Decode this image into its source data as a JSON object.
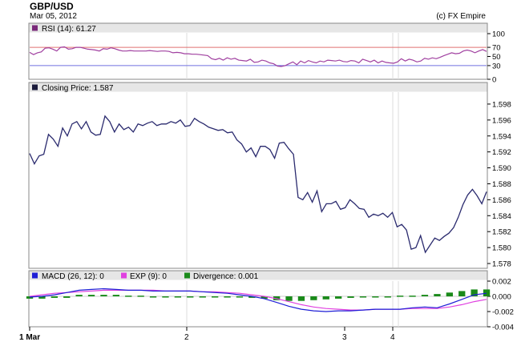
{
  "header": {
    "title": "GBP/USD",
    "date": "Mar 05, 2012",
    "copyright": "(c) FX Empire"
  },
  "colors": {
    "rsi_line": "#a040a0",
    "rsi_fill": "#5050e0",
    "price_line": "#2a2a6e",
    "macd_line": "#1f1fd6",
    "exp_line": "#e040e0",
    "divergence": "#1a8a1a",
    "overbought": "#e07070",
    "oversold": "#7070e0",
    "panel_header": "#e6e6e6"
  },
  "x_axis": {
    "ticks": [
      "1 Mar",
      "2",
      "3",
      "4"
    ]
  },
  "chart_data": [
    {
      "type": "line",
      "title": "RSI (14): 61.27",
      "legend": "RSI (14): 61.27",
      "ylim": [
        0,
        100
      ],
      "yticks": [
        0,
        30,
        50,
        70,
        100
      ],
      "levels": [
        30,
        70
      ],
      "values": [
        59,
        54,
        58,
        60,
        68,
        69,
        66,
        62,
        70,
        71,
        66,
        67,
        70,
        70,
        68,
        66,
        65,
        64,
        62,
        67,
        66,
        69,
        67,
        64,
        62,
        62,
        63,
        62,
        62,
        62,
        62,
        63,
        62,
        61,
        62,
        62,
        61,
        58,
        59,
        58,
        56,
        56,
        55,
        55,
        54,
        53,
        52,
        45,
        43,
        46,
        42,
        47,
        44,
        46,
        42,
        41,
        40,
        44,
        37,
        38,
        42,
        40,
        36,
        34,
        29,
        28,
        30,
        34,
        38,
        32,
        40,
        36,
        41,
        38,
        36,
        40,
        38,
        42,
        41,
        40,
        42,
        39,
        38,
        41,
        40,
        36,
        44,
        41,
        38,
        42,
        36,
        40,
        37,
        36,
        35,
        38,
        45,
        40,
        44,
        42,
        38,
        40,
        46,
        44,
        47,
        45,
        48,
        52,
        55,
        58,
        56,
        57,
        62,
        64,
        62,
        58,
        62,
        65,
        61
      ]
    },
    {
      "type": "line",
      "title": "Closing Price: 1.587",
      "legend": "Closing Price: 1.587",
      "ylim": [
        1.5775,
        1.5995
      ],
      "yticks": [
        1.578,
        1.58,
        1.582,
        1.584,
        1.586,
        1.588,
        1.59,
        1.592,
        1.594,
        1.596,
        1.598
      ],
      "values": [
        1.5918,
        1.5905,
        1.5915,
        1.5917,
        1.5942,
        1.5936,
        1.5927,
        1.595,
        1.594,
        1.5955,
        1.5958,
        1.5949,
        1.5958,
        1.5945,
        1.5941,
        1.5942,
        1.5965,
        1.5958,
        1.5945,
        1.5955,
        1.5948,
        1.5951,
        1.5945,
        1.5955,
        1.5953,
        1.5956,
        1.5958,
        1.5953,
        1.5955,
        1.5955,
        1.5958,
        1.5956,
        1.596,
        1.5952,
        1.5953,
        1.5962,
        1.5958,
        1.5955,
        1.5951,
        1.5949,
        1.5947,
        1.5948,
        1.5944,
        1.5945,
        1.5935,
        1.593,
        1.592,
        1.5925,
        1.5914,
        1.5927,
        1.5927,
        1.5923,
        1.5912,
        1.5931,
        1.5932,
        1.5924,
        1.5917,
        1.5863,
        1.586,
        1.5869,
        1.5857,
        1.5871,
        1.5845,
        1.5855,
        1.5855,
        1.5858,
        1.5848,
        1.585,
        1.586,
        1.5855,
        1.5849,
        1.5848,
        1.5838,
        1.5842,
        1.584,
        1.5843,
        1.5838,
        1.5844,
        1.5826,
        1.5829,
        1.5822,
        1.5798,
        1.58,
        1.5815,
        1.5794,
        1.5803,
        1.5812,
        1.5809,
        1.5814,
        1.5818,
        1.5825,
        1.5838,
        1.5854,
        1.5866,
        1.5873,
        1.5865,
        1.5855,
        1.587
      ]
    },
    {
      "type": "line",
      "title": "MACD (26, 12): 0",
      "legend": [
        {
          "name": "MACD (26, 12): 0",
          "color": "#1f1fd6"
        },
        {
          "name": "EXP (9): 0",
          "color": "#e040e0"
        },
        {
          "name": "Divergence: 0.001",
          "color": "#1a8a1a"
        }
      ],
      "ylim": [
        -0.004,
        0.002
      ],
      "yticks": [
        -0.004,
        -0.002,
        0.0,
        0.002
      ],
      "ytick_labels": [
        "-0.004",
        "-0.002",
        "0.000",
        "0.002"
      ],
      "series": [
        {
          "name": "MACD (26, 12): 0",
          "values": [
            -0.0001,
            0.0,
            0.0002,
            0.0005,
            0.0008,
            0.0009,
            0.001,
            0.0009,
            0.0008,
            0.0008,
            0.0007,
            0.0007,
            0.0007,
            0.0007,
            0.0006,
            0.0005,
            0.0004,
            0.0002,
            0.0,
            -0.0003,
            -0.0008,
            -0.0013,
            -0.0017,
            -0.0019,
            -0.002,
            -0.0019,
            -0.0019,
            -0.0018,
            -0.0017,
            -0.0017,
            -0.0017,
            -0.0015,
            -0.0014,
            -0.0015,
            -0.001,
            -0.0004,
            0.0002,
            0.0004
          ]
        },
        {
          "name": "EXP (9): 0",
          "values": [
            0.0,
            0.0002,
            0.0004,
            0.0005,
            0.0006,
            0.0007,
            0.0008,
            0.0008,
            0.0008,
            0.0008,
            0.0008,
            0.0007,
            0.0007,
            0.0007,
            0.0006,
            0.0006,
            0.0005,
            0.0004,
            0.0002,
            0.0,
            -0.0003,
            -0.0007,
            -0.0011,
            -0.0014,
            -0.0016,
            -0.0017,
            -0.0018,
            -0.0018,
            -0.0017,
            -0.0017,
            -0.0017,
            -0.0016,
            -0.0016,
            -0.0016,
            -0.0014,
            -0.0011,
            -0.0007,
            -0.0004
          ]
        },
        {
          "name": "Divergence: 0.001",
          "values": [
            -0.0003,
            -0.0003,
            -0.0002,
            -0.0002,
            0.0002,
            0.0002,
            0.0002,
            0.0002,
            0.0001,
            0.0001,
            0.0,
            0.0,
            0.0,
            0.0,
            0.0,
            0.0,
            0.0,
            -0.0001,
            -0.0002,
            -0.0003,
            -0.0005,
            -0.0006,
            -0.0006,
            -0.0005,
            -0.0004,
            -0.0003,
            -0.0002,
            -0.0001,
            0.0,
            0.0,
            0.0001,
            0.0001,
            0.0002,
            0.0003,
            0.0005,
            0.0007,
            0.0009,
            0.0009
          ]
        }
      ]
    }
  ]
}
